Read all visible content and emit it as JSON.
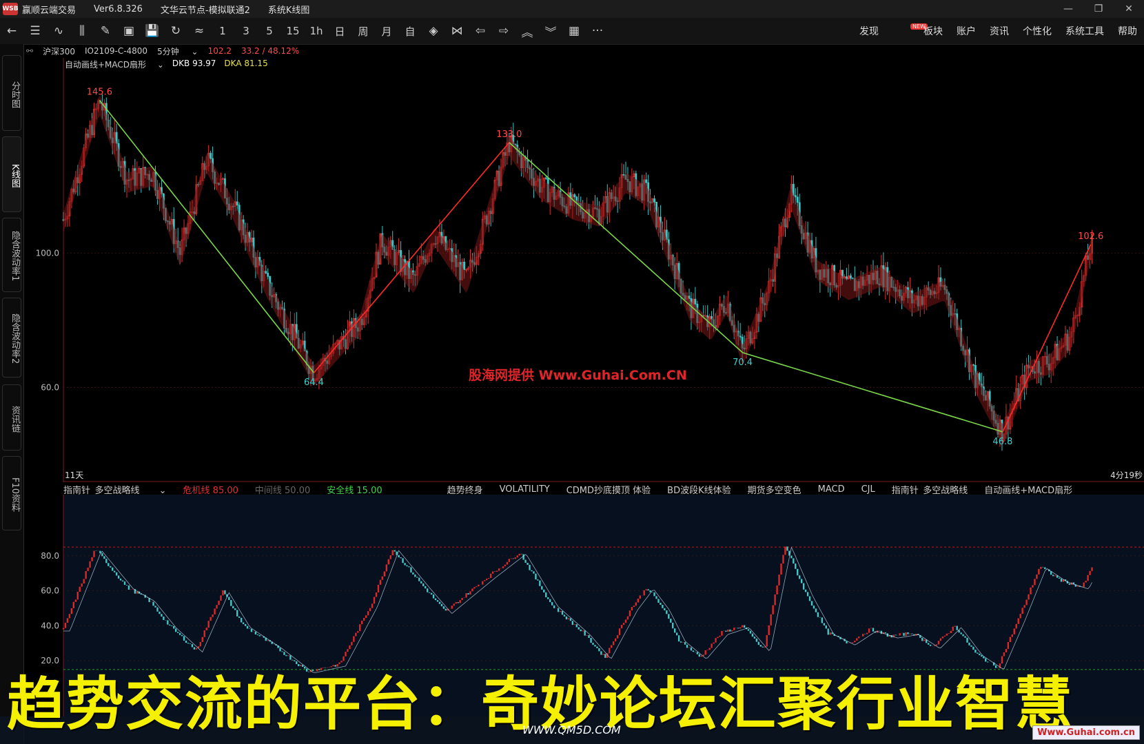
{
  "window": {
    "logo_text": "WSB",
    "app_name": "赢顺云端交易",
    "version": "Ver6.8.326",
    "node": "文华云节点-模拟联通2",
    "view": "系统K线图",
    "controls": [
      "—",
      "❐",
      "✕"
    ]
  },
  "toolbar": {
    "icons": [
      "back-arrow",
      "list",
      "line-chart",
      "kline",
      "draw",
      "layout",
      "save",
      "refresh",
      "compare"
    ],
    "periods": [
      "1",
      "3",
      "5",
      "15",
      "1h",
      "日",
      "周",
      "月",
      "自"
    ],
    "nav_icons": [
      "◈",
      "⋈",
      "⇦",
      "⇨",
      "︽",
      "︾",
      "▦",
      "···"
    ],
    "menu": [
      "发现",
      "板块",
      "账户",
      "资讯",
      "个性化",
      "系统工具",
      "帮助"
    ],
    "new_badge": "NEW"
  },
  "sidebar": {
    "tabs": [
      "分时图",
      "K线图",
      "隐含波动率1",
      "隐含波动率2",
      "资讯链",
      "F10资料"
    ]
  },
  "info": {
    "index_name": "沪深300",
    "contract": "IO2109-C-4800",
    "period": "5分钟",
    "price": "102.2",
    "change": "33.2 / 48.12%"
  },
  "indicator": {
    "name": "自动画线+MACD扇形",
    "dkb": "DKB 93.97",
    "dka": "DKA 81.15"
  },
  "main_chart": {
    "price_levels": [
      {
        "label": "100.0",
        "value": 100
      },
      {
        "label": "60.0",
        "value": 60
      }
    ],
    "peaks": [
      {
        "label": "145.6",
        "t": 0.034,
        "v": 145.6,
        "color": "#ff4a4a",
        "pos": "above"
      },
      {
        "label": "64.4",
        "t": 0.236,
        "v": 64.4,
        "color": "#3fcfcf",
        "pos": "below"
      },
      {
        "label": "133.0",
        "t": 0.42,
        "v": 133.0,
        "color": "#ff4a4a",
        "pos": "above"
      },
      {
        "label": "70.4",
        "t": 0.64,
        "v": 70.4,
        "color": "#3fcfcf",
        "pos": "below"
      },
      {
        "label": "46.8",
        "t": 0.885,
        "v": 46.8,
        "color": "#3fcfcf",
        "pos": "below"
      },
      {
        "label": "102.6",
        "t": 0.968,
        "v": 102.6,
        "color": "#ff4a4a",
        "pos": "above"
      }
    ],
    "left_corner": "11天",
    "right_corner": "4分19秒",
    "watermark": "股海网提供 Www.Guhai.Com.CN"
  },
  "chart_data": {
    "type": "line",
    "title": "",
    "series": [
      {
        "values": [
          [
            0,
            110
          ],
          [
            0.034,
            145.6
          ],
          [
            0.06,
            122
          ],
          [
            0.084,
            124
          ],
          [
            0.11,
            100
          ],
          [
            0.135,
            128
          ],
          [
            0.16,
            114
          ],
          [
            0.19,
            92
          ],
          [
            0.236,
            64.4
          ],
          [
            0.28,
            80
          ],
          [
            0.3,
            104
          ],
          [
            0.33,
            92
          ],
          [
            0.35,
            106
          ],
          [
            0.38,
            92
          ],
          [
            0.42,
            133.0
          ],
          [
            0.45,
            120
          ],
          [
            0.48,
            114
          ],
          [
            0.505,
            112
          ],
          [
            0.53,
            122
          ],
          [
            0.55,
            118
          ],
          [
            0.59,
            84
          ],
          [
            0.61,
            78
          ],
          [
            0.625,
            86
          ],
          [
            0.64,
            70.4
          ],
          [
            0.665,
            90
          ],
          [
            0.685,
            118
          ],
          [
            0.71,
            96
          ],
          [
            0.74,
            90
          ],
          [
            0.77,
            94
          ],
          [
            0.8,
            86
          ],
          [
            0.83,
            90
          ],
          [
            0.86,
            62
          ],
          [
            0.885,
            46.8
          ],
          [
            0.91,
            66
          ],
          [
            0.93,
            68
          ],
          [
            0.95,
            76
          ],
          [
            0.968,
            102.6
          ]
        ]
      }
    ],
    "ylim": [
      40,
      150
    ]
  },
  "lower_tabs": {
    "selected": "指南针_多空战略线",
    "params": [
      {
        "text": "危机线 85.00",
        "color": "#e03030"
      },
      {
        "text": "中间线 50.00",
        "color": "#666"
      },
      {
        "text": "安全线 15.00",
        "color": "#3ed24a"
      }
    ],
    "tabs": [
      "趋势终身",
      "VOLATILITY",
      "CDMD抄底摸顶 体验",
      "BD波段K线体验",
      "期货多空变色",
      "MACD",
      "CJL",
      "指南针_多空战略线",
      "自动画线+MACD扇形"
    ]
  },
  "lower_chart": {
    "levels": [
      {
        "label": "80.0",
        "value": 80
      },
      {
        "label": "60.0",
        "value": 60
      },
      {
        "label": "40.0",
        "value": 40
      },
      {
        "label": "20.0",
        "value": 20
      }
    ],
    "danger": 85,
    "safe": 15,
    "series": [
      [
        0,
        38
      ],
      [
        0.03,
        84
      ],
      [
        0.06,
        62
      ],
      [
        0.08,
        55
      ],
      [
        0.1,
        40
      ],
      [
        0.125,
        26
      ],
      [
        0.15,
        60
      ],
      [
        0.17,
        40
      ],
      [
        0.2,
        28
      ],
      [
        0.23,
        14
      ],
      [
        0.26,
        18
      ],
      [
        0.29,
        52
      ],
      [
        0.31,
        84
      ],
      [
        0.34,
        62
      ],
      [
        0.36,
        48
      ],
      [
        0.4,
        68
      ],
      [
        0.43,
        82
      ],
      [
        0.46,
        52
      ],
      [
        0.49,
        36
      ],
      [
        0.51,
        22
      ],
      [
        0.535,
        50
      ],
      [
        0.55,
        62
      ],
      [
        0.565,
        50
      ],
      [
        0.58,
        32
      ],
      [
        0.6,
        22
      ],
      [
        0.62,
        36
      ],
      [
        0.64,
        40
      ],
      [
        0.66,
        26
      ],
      [
        0.68,
        86
      ],
      [
        0.7,
        58
      ],
      [
        0.72,
        36
      ],
      [
        0.74,
        30
      ],
      [
        0.76,
        38
      ],
      [
        0.78,
        34
      ],
      [
        0.8,
        36
      ],
      [
        0.82,
        28
      ],
      [
        0.84,
        40
      ],
      [
        0.86,
        24
      ],
      [
        0.88,
        16
      ],
      [
        0.9,
        44
      ],
      [
        0.92,
        74
      ],
      [
        0.94,
        66
      ],
      [
        0.96,
        62
      ],
      [
        0.97,
        74
      ]
    ]
  },
  "overlay": {
    "banner": "趋势交流的平台：奇妙论坛汇聚行业智慧",
    "site": "WWW.QM5D.COM",
    "guhai": "Www.Guhai.com.cn"
  }
}
